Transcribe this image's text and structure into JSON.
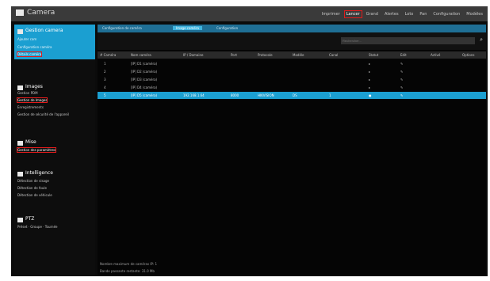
{
  "app": {
    "title": "Camera"
  },
  "top_menu": [
    "Imprimer",
    "Lancer",
    "Grand",
    "Alertes",
    "Loto",
    "Pan",
    "Configuration",
    "Modèles"
  ],
  "sidebar": {
    "sections": [
      {
        "title": "Gestion camera",
        "items": [
          "Ajouter cam",
          "Configuration caméra",
          "Détails caméra"
        ]
      },
      {
        "title": "Images",
        "items": [
          "Gestion PDM",
          "Gestion de Images",
          "Enregistrements",
          "Gestion de sécurité de l'appareil"
        ]
      },
      {
        "title": "Mise",
        "items": [
          "Gestion des paramètres"
        ]
      },
      {
        "title": "Intelligence",
        "items": [
          "Détection de visage",
          "Détection de foule",
          "Détection de véhicule"
        ]
      },
      {
        "title": "PTZ",
        "items": [
          "Préset · Groupe · Tournée"
        ]
      }
    ]
  },
  "tabs": [
    "Configuration de caméra",
    "Image caméra",
    "Configuration"
  ],
  "search": {
    "placeholder": "Rechercher..."
  },
  "table": {
    "headers": [
      "# Caméra",
      "Nom caméra",
      "IP / Domaine",
      "Port",
      "Protocole",
      "Modèle",
      "Canal",
      "Statut",
      "Edit",
      "Activé",
      "Options"
    ],
    "rows": [
      {
        "num": "1",
        "name": "[IP] D1 (caméra)",
        "ip": "",
        "port": "",
        "protocol": "",
        "model": "",
        "channel": "",
        "status": "▸",
        "edit": "✎",
        "selected": false
      },
      {
        "num": "2",
        "name": "[IP] D2 (caméra)",
        "ip": "",
        "port": "",
        "protocol": "",
        "model": "",
        "channel": "",
        "status": "▸",
        "edit": "✎",
        "selected": false
      },
      {
        "num": "3",
        "name": "[IP] D3 (caméra)",
        "ip": "",
        "port": "",
        "protocol": "",
        "model": "",
        "channel": "",
        "status": "▸",
        "edit": "✎",
        "selected": false
      },
      {
        "num": "4",
        "name": "[IP] D4 (caméra)",
        "ip": "",
        "port": "",
        "protocol": "",
        "model": "",
        "channel": "",
        "status": "▸",
        "edit": "✎",
        "selected": false
      },
      {
        "num": "5",
        "name": "[IP] D5 (caméra)",
        "ip": "192.168.1.64",
        "port": "8000",
        "protocol": "HIKVISION",
        "model": "DS",
        "channel": "1",
        "status": "●",
        "edit": "✎",
        "selected": true
      }
    ]
  },
  "footer": {
    "line1": "Nombre maximum de caméras IP: 1",
    "line2": "Bande passante restante: 31.0 Mb"
  }
}
